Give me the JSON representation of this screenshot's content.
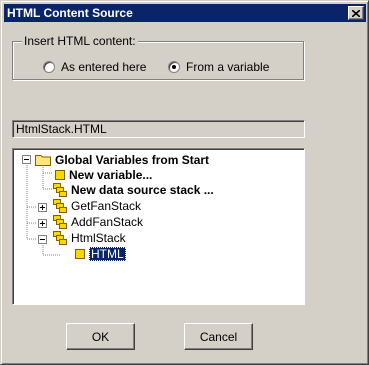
{
  "window": {
    "title": "HTML Content Source"
  },
  "insert_group": {
    "label": "Insert HTML content:",
    "options": [
      {
        "label": "As entered here",
        "selected": false
      },
      {
        "label": "From a variable",
        "selected": true
      }
    ]
  },
  "path_field": {
    "value": "HtmlStack.HTML"
  },
  "tree": {
    "items": [
      {
        "label": "Global Variables from Start",
        "icon": "folder-icon",
        "expander": "minus"
      },
      {
        "label": "New variable...",
        "icon": "variable-icon"
      },
      {
        "label": "New data source stack ...",
        "icon": "stack-icon"
      },
      {
        "label": "GetFanStack",
        "icon": "stack-icon",
        "expander": "plus"
      },
      {
        "label": "AddFanStack",
        "icon": "stack-icon",
        "expander": "plus"
      },
      {
        "label": "HtmlStack",
        "icon": "stack-icon",
        "expander": "minus"
      },
      {
        "label": "HTML",
        "icon": "variable-icon",
        "selected": true
      }
    ]
  },
  "buttons": {
    "ok": "OK",
    "cancel": "Cancel"
  },
  "colors": {
    "titlebar": "#0a246a",
    "face": "#d4d0c8",
    "selection": "#0a246a"
  }
}
